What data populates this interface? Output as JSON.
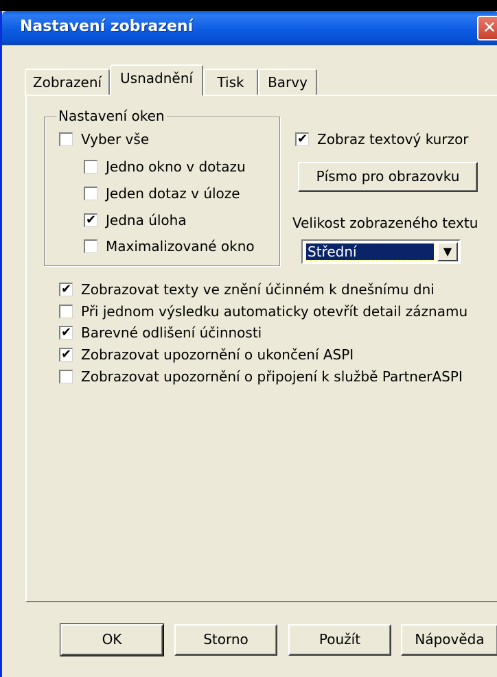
{
  "window": {
    "title": "Nastavení zobrazení",
    "close_glyph": "✕"
  },
  "tabs": [
    {
      "label": "Zobrazení",
      "active": false
    },
    {
      "label": "Usnadnění",
      "active": true
    },
    {
      "label": "Tisk",
      "active": false
    },
    {
      "label": "Barvy",
      "active": false
    }
  ],
  "group": {
    "title": "Nastavení oken",
    "items": [
      {
        "label": "Vyber vše",
        "checked": false
      },
      {
        "label": "Jedno okno v dotazu",
        "checked": false
      },
      {
        "label": "Jeden dotaz v úloze",
        "checked": false
      },
      {
        "label": "Jedna úloha",
        "checked": true
      },
      {
        "label": "Maximalizované okno",
        "checked": false
      }
    ]
  },
  "right": {
    "cursor_checkbox": {
      "label": "Zobraz textový kurzor",
      "checked": true
    },
    "font_button": "Písmo pro obrazovku",
    "size_label": "Velikost zobrazeného textu",
    "size_value": "Střední"
  },
  "options": [
    {
      "label": "Zobrazovat texty ve znění účinném k dnešnímu dni",
      "checked": true
    },
    {
      "label": "Při jednom výsledku automaticky otevřít detail záznamu",
      "checked": false
    },
    {
      "label": "Barevné odlišení účinnosti",
      "checked": true
    },
    {
      "label": "Zobrazovat upozornění o ukončení ASPI",
      "checked": true
    },
    {
      "label": "Zobrazovat upozornění o připojení k službě PartnerASPI",
      "checked": false
    }
  ],
  "buttons": {
    "ok": "OK",
    "cancel": "Storno",
    "apply": "Použít",
    "help": "Nápověda"
  },
  "colors": {
    "titlebar": "#0A5BE0",
    "dialog_bg": "#ECE9D8",
    "selection": "#0A246A"
  },
  "check_glyph": "✔"
}
